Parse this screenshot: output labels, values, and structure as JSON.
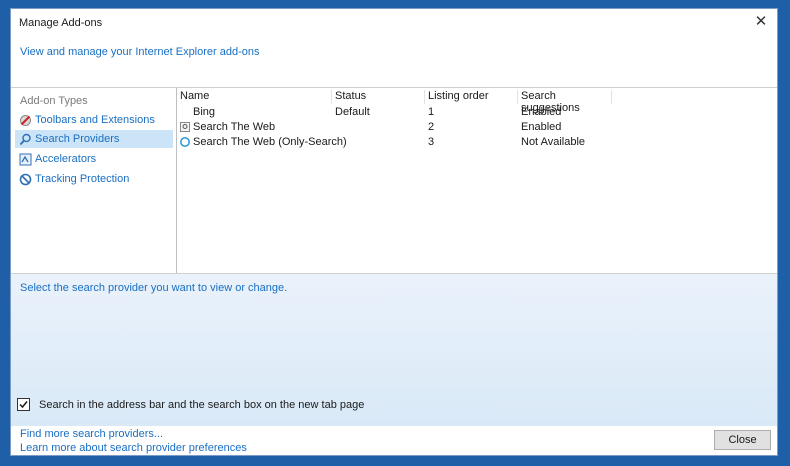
{
  "window": {
    "title": "Manage Add-ons",
    "header_link": "View and manage your Internet Explorer add-ons"
  },
  "sidebar": {
    "heading": "Add-on Types",
    "items": [
      {
        "label": "Toolbars and Extensions",
        "icon": "gear-block-icon",
        "selected": false
      },
      {
        "label": "Search Providers",
        "icon": "magnifier-icon",
        "selected": true
      },
      {
        "label": "Accelerators",
        "icon": "accelerator-icon",
        "selected": false
      },
      {
        "label": "Tracking Protection",
        "icon": "no-sign-icon",
        "selected": false
      }
    ]
  },
  "table": {
    "columns": [
      "Name",
      "Status",
      "Listing order",
      "Search suggestions"
    ],
    "rows": [
      {
        "name": "Bing",
        "status": "Default",
        "order": "1",
        "suggestions": "Enabled",
        "icon": ""
      },
      {
        "name": "Search The Web",
        "status": "",
        "order": "2",
        "suggestions": "Enabled",
        "icon": "page-search-icon"
      },
      {
        "name": "Search The Web (Only-Search)",
        "status": "",
        "order": "3",
        "suggestions": "Not Available",
        "icon": "globe-icon"
      }
    ]
  },
  "details": {
    "prompt": "Select the search provider you want to view or change.",
    "checkbox_label": "Search in the address bar and the search box on the new tab page",
    "checkbox_checked": true
  },
  "footer": {
    "find_more": "Find more search providers...",
    "learn_more": "Learn more about search provider preferences",
    "close_label": "Close"
  },
  "colors": {
    "link": "#1a6fc2",
    "selected_bg": "#cce4f7",
    "frame": "#1f5fa8"
  }
}
